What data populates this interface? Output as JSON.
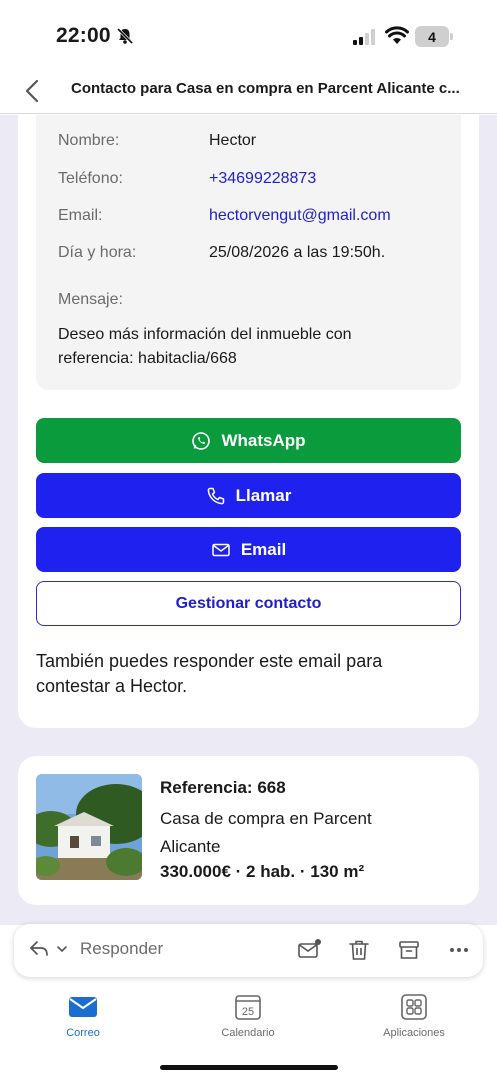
{
  "status": {
    "time": "22:00",
    "battery": "4"
  },
  "header": {
    "title": "Contacto para Casa en compra en Parcent Alicante c..."
  },
  "contact": {
    "name_label": "Nombre:",
    "name": "Hector",
    "phone_label": "Teléfono:",
    "phone": "+34699228873",
    "email_label": "Email:",
    "email": "hectorvengut@gmail.com",
    "date_label": "Día y hora:",
    "date": "25/08/2026 a las 19:50h.",
    "message_label": "Mensaje:",
    "message": "Deseo más información del inmueble con referencia: habitaclia/668"
  },
  "actions": {
    "whatsapp": "WhatsApp",
    "call": "Llamar",
    "email": "Email",
    "manage": "Gestionar contacto"
  },
  "reply_note": "También puedes responder este email para contestar a Hector.",
  "property": {
    "reference": "Referencia: 668",
    "description": "Casa de compra en Parcent Alicante",
    "summary": "330.000€ · 2 hab. · 130 m²"
  },
  "reply_bar": {
    "label": "Responder"
  },
  "tabs": [
    {
      "label": "Correo",
      "active": true
    },
    {
      "label": "Calendario",
      "day": "25"
    },
    {
      "label": "Aplicaciones"
    }
  ],
  "colors": {
    "whatsapp": "#0a9b3d",
    "primary": "#1f22ef",
    "link": "#2222cc",
    "tab_active": "#1a6ecf"
  },
  "icons": [
    "bell-off-icon",
    "signal-icon",
    "wifi-icon",
    "battery-icon",
    "back-chevron-icon",
    "whatsapp-icon",
    "phone-icon",
    "mail-icon",
    "reply-icon",
    "chevron-down-icon",
    "unread-mail-icon",
    "trash-icon",
    "archive-icon",
    "more-icon",
    "mail-tab-icon",
    "calendar-icon",
    "apps-icon"
  ]
}
